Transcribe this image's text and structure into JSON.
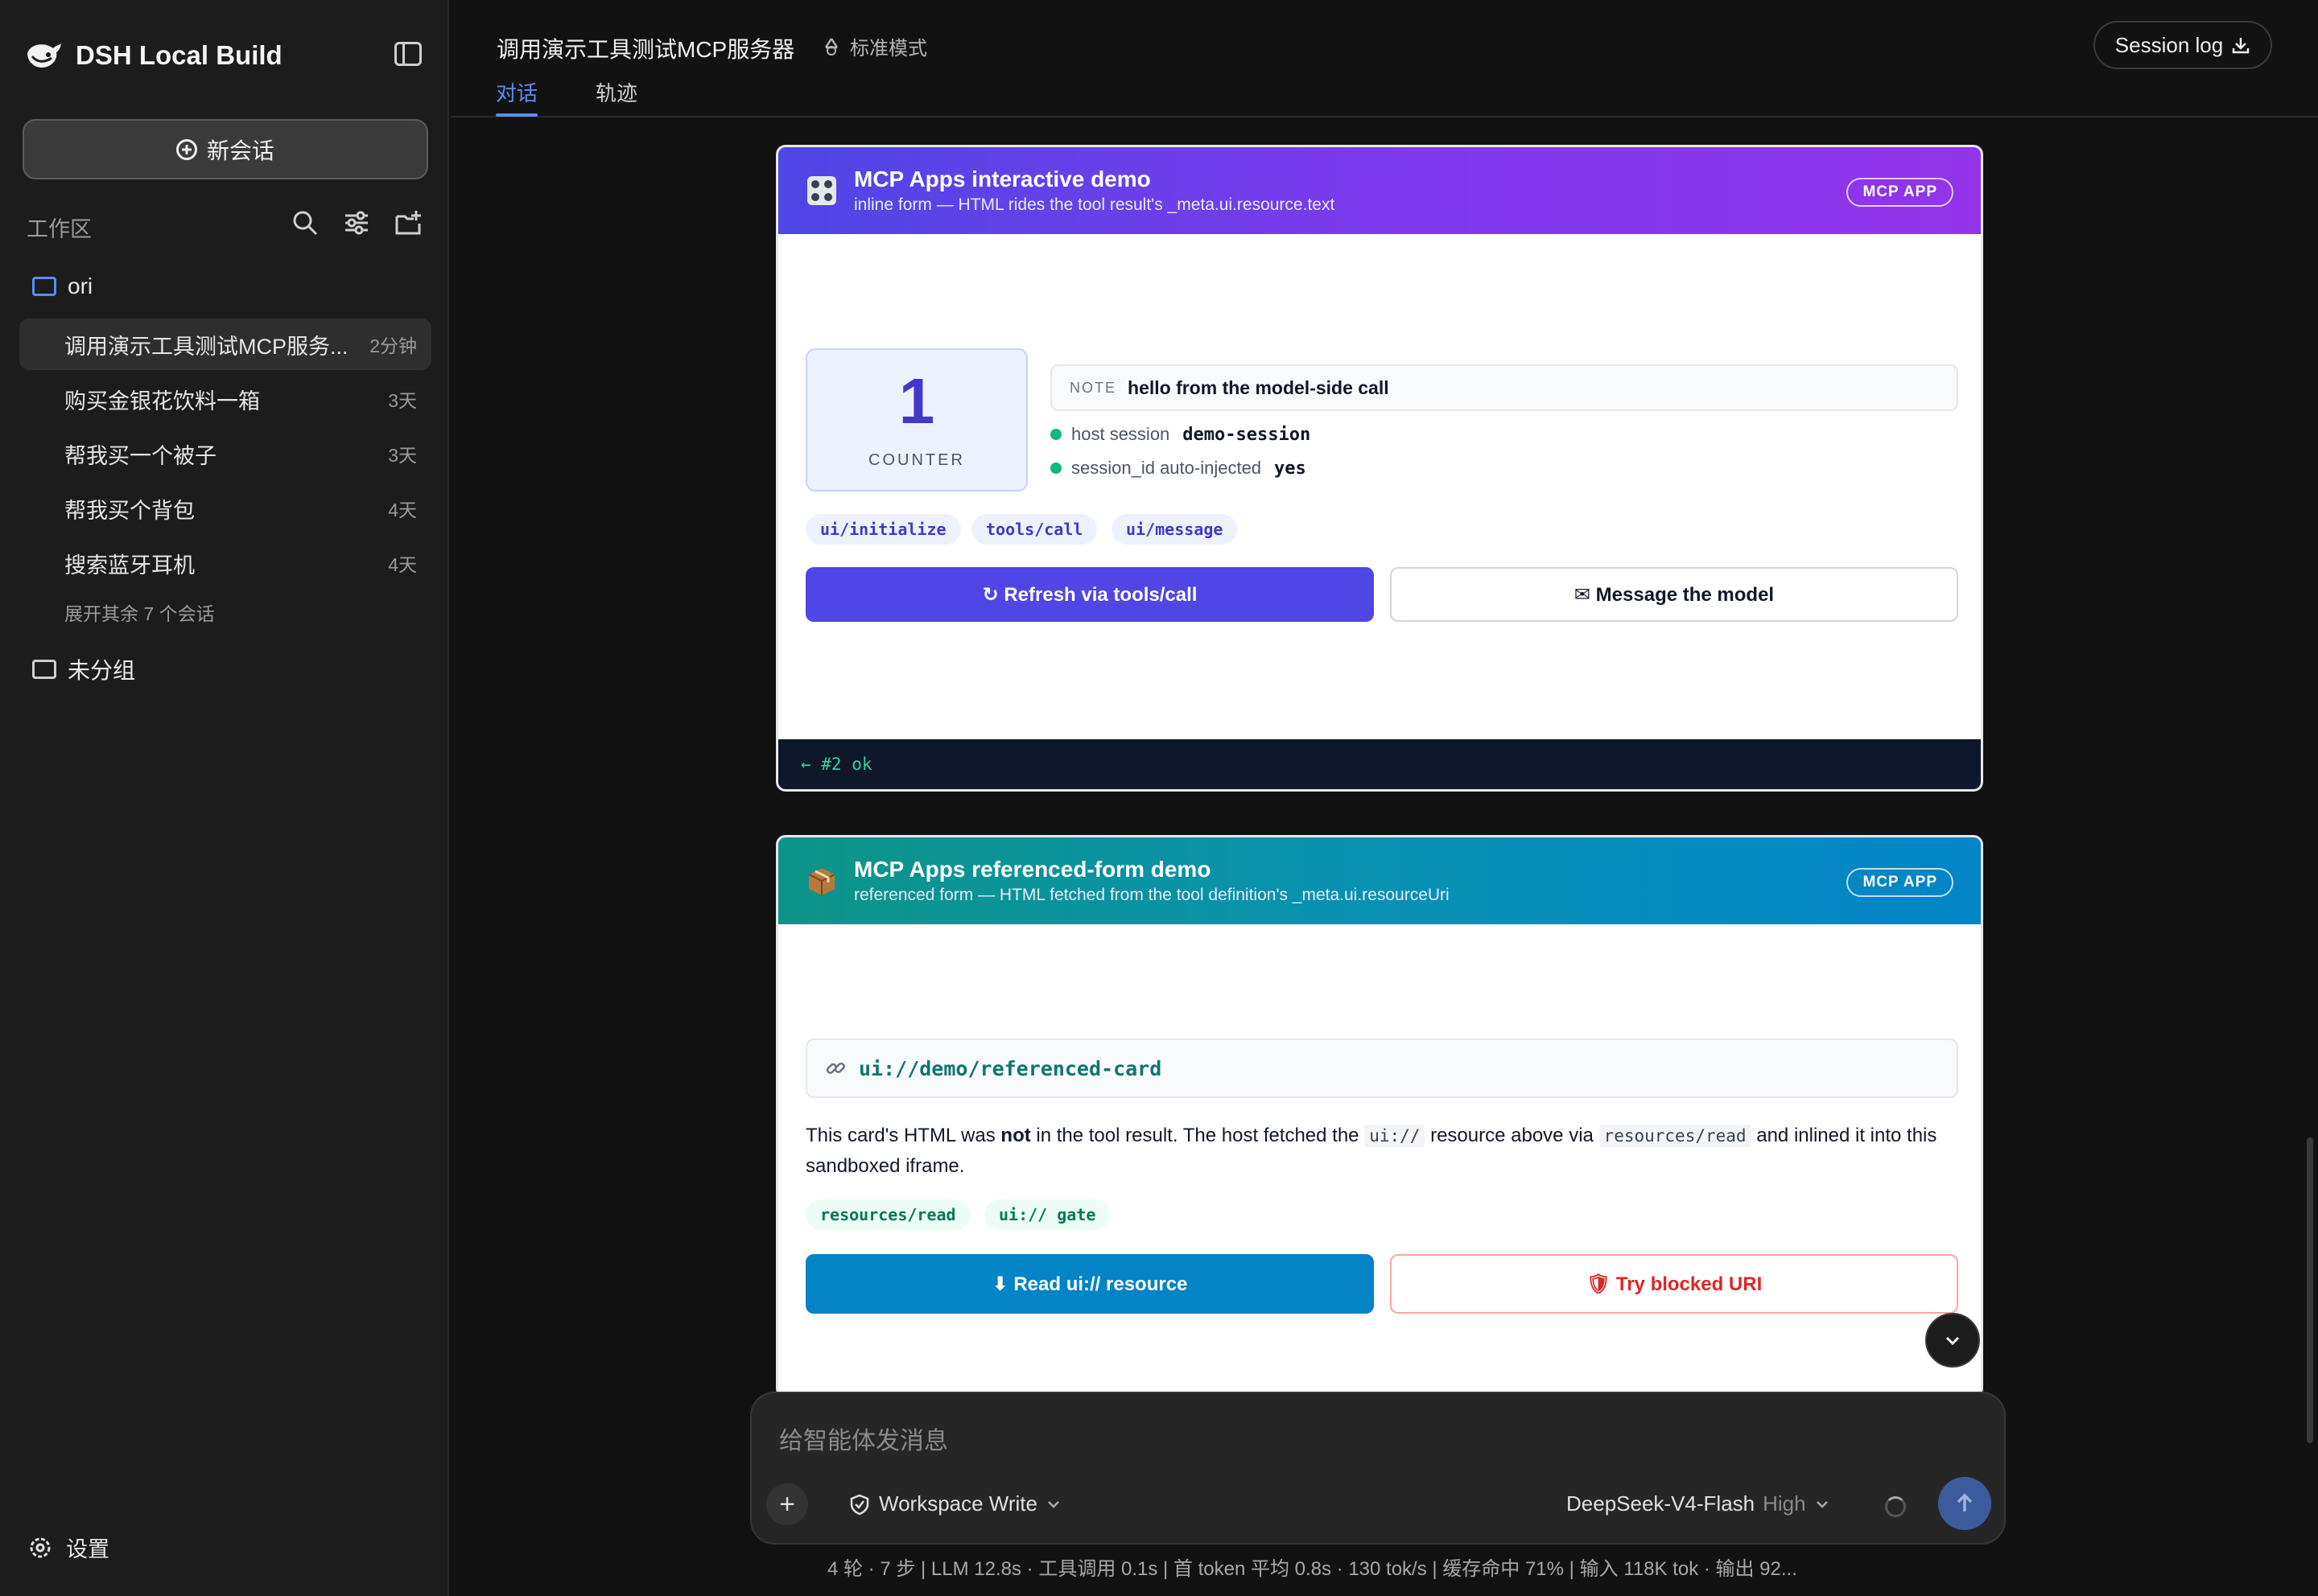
{
  "app": {
    "title": "DSH Local Build"
  },
  "sidebar": {
    "new_chat_label": "新会话",
    "workspace_label": "工作区",
    "folders": [
      {
        "name": "ori"
      },
      {
        "name": "未分组"
      }
    ],
    "sessions": [
      {
        "name": "调用演示工具测试MCP服务...",
        "time": "2分钟"
      },
      {
        "name": "购买金银花饮料一箱",
        "time": "3天"
      },
      {
        "name": "帮我买一个被子",
        "time": "3天"
      },
      {
        "name": "帮我买个背包",
        "time": "4天"
      },
      {
        "name": "搜索蓝牙耳机",
        "time": "4天"
      }
    ],
    "more_sessions": "展开其余 7 个会话",
    "settings_label": "设置"
  },
  "header": {
    "conversation_title": "调用演示工具测试MCP服务器",
    "mode": "标准模式",
    "tabs": [
      {
        "label": "对话"
      },
      {
        "label": "轨迹"
      }
    ],
    "session_log": "Session log"
  },
  "card1": {
    "title": "MCP Apps interactive demo",
    "subtitle": "inline form — HTML rides the tool result's _meta.ui.resource.text",
    "badge": "MCP APP",
    "counter_value": "1",
    "counter_label": "COUNTER",
    "note_key": "NOTE",
    "note_value": "hello from the model-side call",
    "host_session_label": "host session",
    "host_session_value": "demo-session",
    "session_id_label": "session_id auto-injected",
    "session_id_value": "yes",
    "chips": [
      "ui/initialize",
      "tools/call",
      "ui/message"
    ],
    "refresh_button": "↻ Refresh via tools/call",
    "message_button": "✉ Message the model",
    "log": "← #2 ok"
  },
  "card2": {
    "title": "MCP Apps referenced-form demo",
    "subtitle": "referenced form — HTML fetched from the tool definition's _meta.ui.resourceUri",
    "badge": "MCP APP",
    "uri": "ui://demo/referenced-card",
    "desc_1": "This card's HTML was ",
    "desc_bold": "not",
    "desc_2": " in the tool result. The host fetched the ",
    "desc_code_1": "ui://",
    "desc_3": " resource above via ",
    "desc_code_2": "resources/read",
    "desc_4": " and inlined it into this sandboxed iframe.",
    "chips": [
      "resources/read",
      "ui:// gate"
    ],
    "read_button": "⬇ Read ui:// resource",
    "blocked_button": "🛡 Try blocked URI"
  },
  "composer": {
    "placeholder": "给智能体发消息",
    "permission": "Workspace Write",
    "model": "DeepSeek-V4-Flash",
    "level": "High"
  },
  "stats": "4 轮 · 7 步  |  LLM 12.8s · 工具调用 0.1s  |  首 token 平均 0.8s · 130 tok/s  |  缓存命中 71%  |  输入 118K tok · 输出 92..."
}
